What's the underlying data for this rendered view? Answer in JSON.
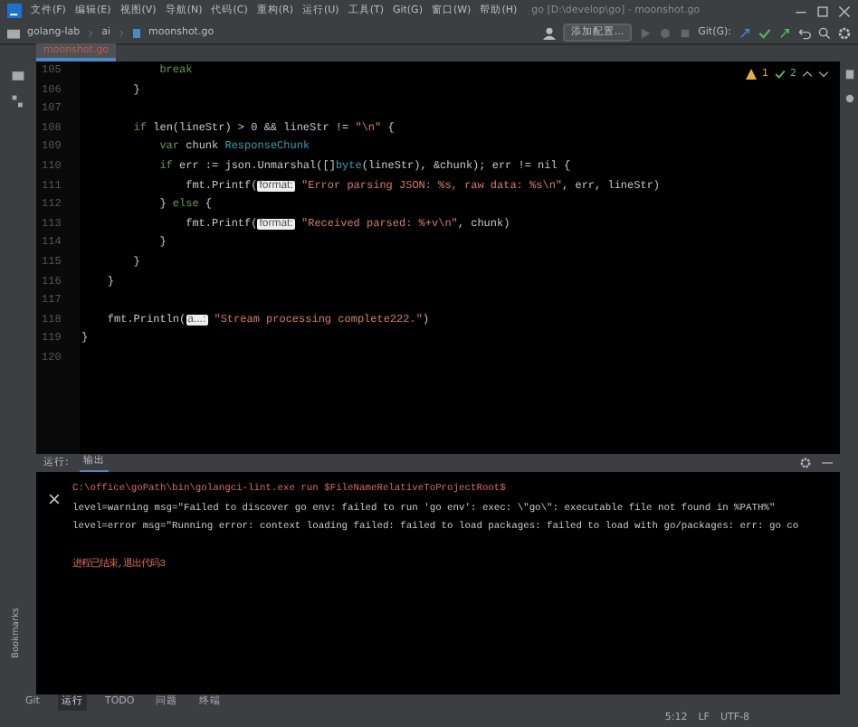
{
  "menu": [
    "文件(F)",
    "编辑(E)",
    "视图(V)",
    "导航(N)",
    "代码(C)",
    "重构(R)",
    "运行(U)",
    "工具(T)",
    "Git(G)",
    "窗口(W)",
    "帮助(H)"
  ],
  "window": {
    "title": "go [D:\\develop\\go] - moonshot.go"
  },
  "breadcrumb": [
    "golang-lab",
    "ai",
    "moonshot.go"
  ],
  "run_config": "添加配置...",
  "git_label": "Git(G):",
  "tabs": [
    {
      "label": "moonshot.go",
      "selected": true
    }
  ],
  "inspections": {
    "warnings": "1",
    "weak": "2"
  },
  "code_lines": [
    {
      "number": "105",
      "tokens": [
        {
          "kind": "keyword",
          "text": "            break"
        }
      ]
    },
    {
      "number": "106",
      "tokens": [
        {
          "kind": "plain",
          "text": "        }"
        }
      ]
    },
    {
      "number": "107"
    },
    {
      "number": "108",
      "tokens": [
        {
          "kind": "keyword",
          "text": "        if"
        },
        {
          "kind": "plain",
          "text": " len(lineStr) > 0 && lineStr != "
        },
        {
          "kind": "string",
          "text": "\"\\n\""
        },
        {
          "kind": "plain",
          "text": " {"
        }
      ]
    },
    {
      "number": "109",
      "tokens": [
        {
          "kind": "keyword",
          "text": "            var"
        },
        {
          "kind": "plain",
          "text": " chunk "
        },
        {
          "kind": "type",
          "text": "ResponseChunk"
        }
      ]
    },
    {
      "number": "110",
      "tokens": [
        {
          "kind": "keyword",
          "text": "            if"
        },
        {
          "kind": "plain",
          "text": " err := json.Unmarshal([]"
        },
        {
          "kind": "type",
          "text": "byte"
        },
        {
          "kind": "plain",
          "text": "(lineStr), &chunk); err != nil {"
        }
      ]
    },
    {
      "number": "111",
      "tokens": [
        {
          "kind": "plain",
          "text": "                fmt.Printf("
        },
        {
          "kind": "hint",
          "text": "format:"
        },
        {
          "kind": "string",
          "text": " \"Error parsing JSON: %s, raw data: %s\\n\""
        },
        {
          "kind": "plain",
          "text": ", err, lineStr)"
        }
      ]
    },
    {
      "number": "112",
      "tokens": [
        {
          "kind": "plain",
          "text": "            } "
        },
        {
          "kind": "keyword",
          "text": "else"
        },
        {
          "kind": "plain",
          "text": " {"
        }
      ]
    },
    {
      "number": "113",
      "tokens": [
        {
          "kind": "plain",
          "text": "                fmt.Printf("
        },
        {
          "kind": "hint",
          "text": "format:"
        },
        {
          "kind": "string",
          "text": " \"Received parsed: %+v\\n\""
        },
        {
          "kind": "plain",
          "text": ", chunk)"
        }
      ]
    },
    {
      "number": "114",
      "tokens": [
        {
          "kind": "plain",
          "text": "            }"
        }
      ]
    },
    {
      "number": "115",
      "tokens": [
        {
          "kind": "plain",
          "text": "        }"
        }
      ]
    },
    {
      "number": "116",
      "tokens": [
        {
          "kind": "plain",
          "text": "    }"
        }
      ]
    },
    {
      "number": "117"
    },
    {
      "number": "118",
      "tokens": [
        {
          "kind": "plain",
          "text": "    fmt.Println("
        },
        {
          "kind": "hint",
          "text": "a...:"
        },
        {
          "kind": "string",
          "text": " \"Stream processing complete222.\""
        },
        {
          "kind": "plain",
          "text": ")"
        }
      ]
    },
    {
      "number": "119",
      "tokens": [
        {
          "kind": "plain",
          "text": "}"
        }
      ]
    },
    {
      "number": "120"
    }
  ],
  "run_panel": {
    "label": "运行:",
    "tab": "输出"
  },
  "console": [
    {
      "kind": "command",
      "text": "C:\\office\\goPath\\bin\\golangci-lint.exe run $FileNameRelativeToProjectRoot$"
    },
    {
      "kind": "output",
      "text": "level=warning msg=\"Failed to discover go env: failed to run 'go env': exec: \\\"go\\\": executable file not found in %PATH%\""
    },
    {
      "kind": "output",
      "text": "level=error msg=\"Running error: context loading failed: failed to load packages: failed to load with go/packages: err: go co"
    },
    {
      "kind": "blank"
    },
    {
      "kind": "exit",
      "text": "进程已结束,退出代码3"
    }
  ],
  "left_stripe": [
    "Bookmarks"
  ],
  "tool_tabs": [
    {
      "label": "Git",
      "selected": false
    },
    {
      "label": "运行",
      "selected": true
    },
    {
      "label": "TODO",
      "selected": false
    },
    {
      "label": "问题",
      "selected": false
    },
    {
      "label": "终端",
      "selected": false
    }
  ],
  "status": [
    "5:12",
    "LF",
    "UTF-8"
  ]
}
